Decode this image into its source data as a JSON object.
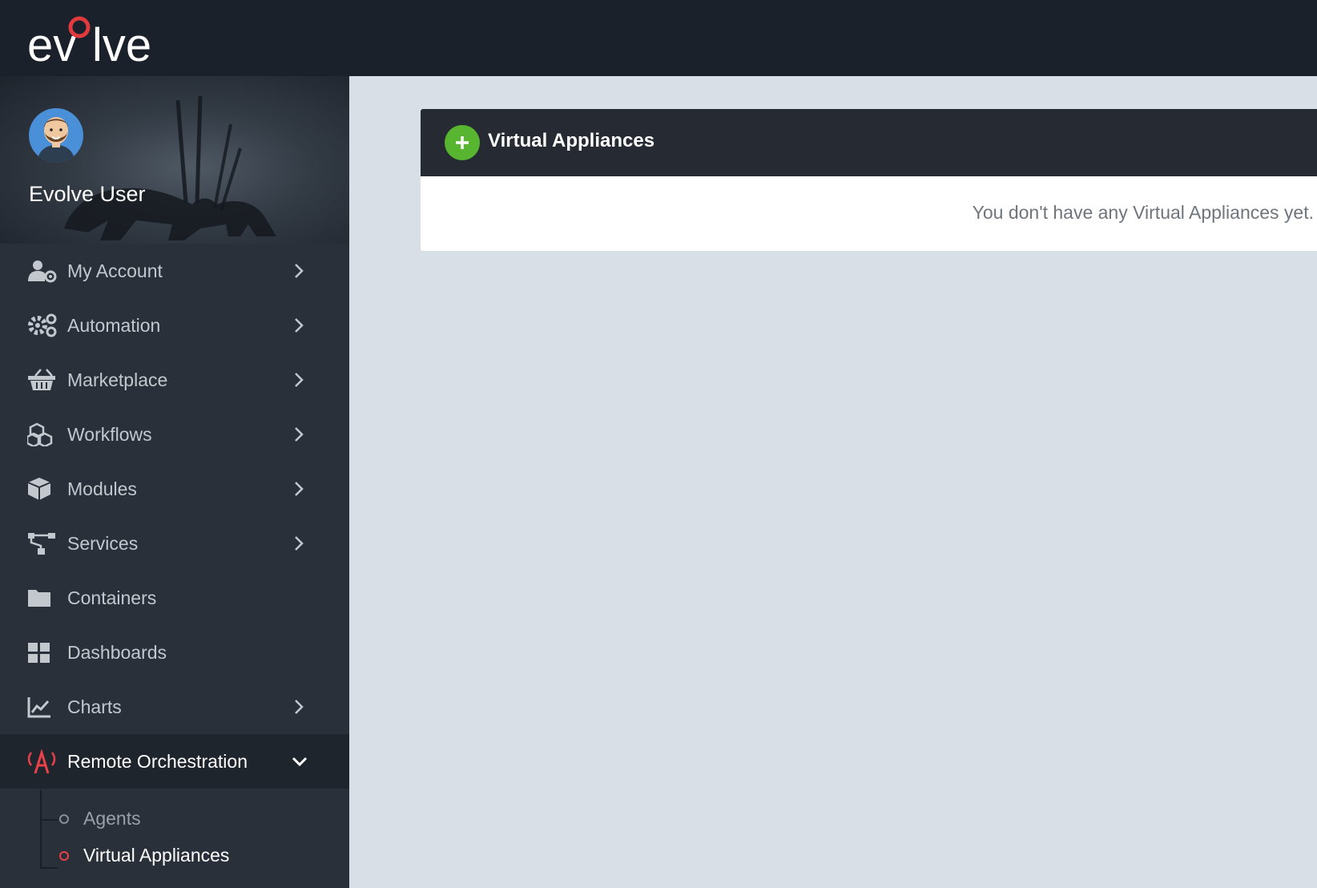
{
  "brand": {
    "logo_text": "evolve"
  },
  "user": {
    "name": "Evolve User"
  },
  "nav": {
    "items": [
      {
        "label": "My Account",
        "icon": "user-gear-icon",
        "has_chevron": true
      },
      {
        "label": "Automation",
        "icon": "gears-icon",
        "has_chevron": true
      },
      {
        "label": "Marketplace",
        "icon": "basket-icon",
        "has_chevron": true
      },
      {
        "label": "Workflows",
        "icon": "cubes-icon",
        "has_chevron": true
      },
      {
        "label": "Modules",
        "icon": "cube-icon",
        "has_chevron": true
      },
      {
        "label": "Services",
        "icon": "sitemap-icon",
        "has_chevron": true
      },
      {
        "label": "Containers",
        "icon": "folder-icon",
        "has_chevron": false
      },
      {
        "label": "Dashboards",
        "icon": "grid-icon",
        "has_chevron": false
      },
      {
        "label": "Charts",
        "icon": "line-chart-icon",
        "has_chevron": true
      },
      {
        "label": "Remote Orchestration",
        "icon": "broadcast-tower-icon",
        "expanded": true,
        "active": true
      }
    ],
    "sub_items": [
      {
        "label": "Agents",
        "active": false
      },
      {
        "label": "Virtual Appliances",
        "active": true
      }
    ]
  },
  "panel": {
    "title": "Virtual Appliances",
    "empty_message": "You don't have any Virtual Appliances yet."
  },
  "colors": {
    "topbar": "#1b212a",
    "sidebar": "#2a3039",
    "accent_red": "#e8414a",
    "add_green": "#58b530",
    "content_bg": "#d9dfe6"
  }
}
